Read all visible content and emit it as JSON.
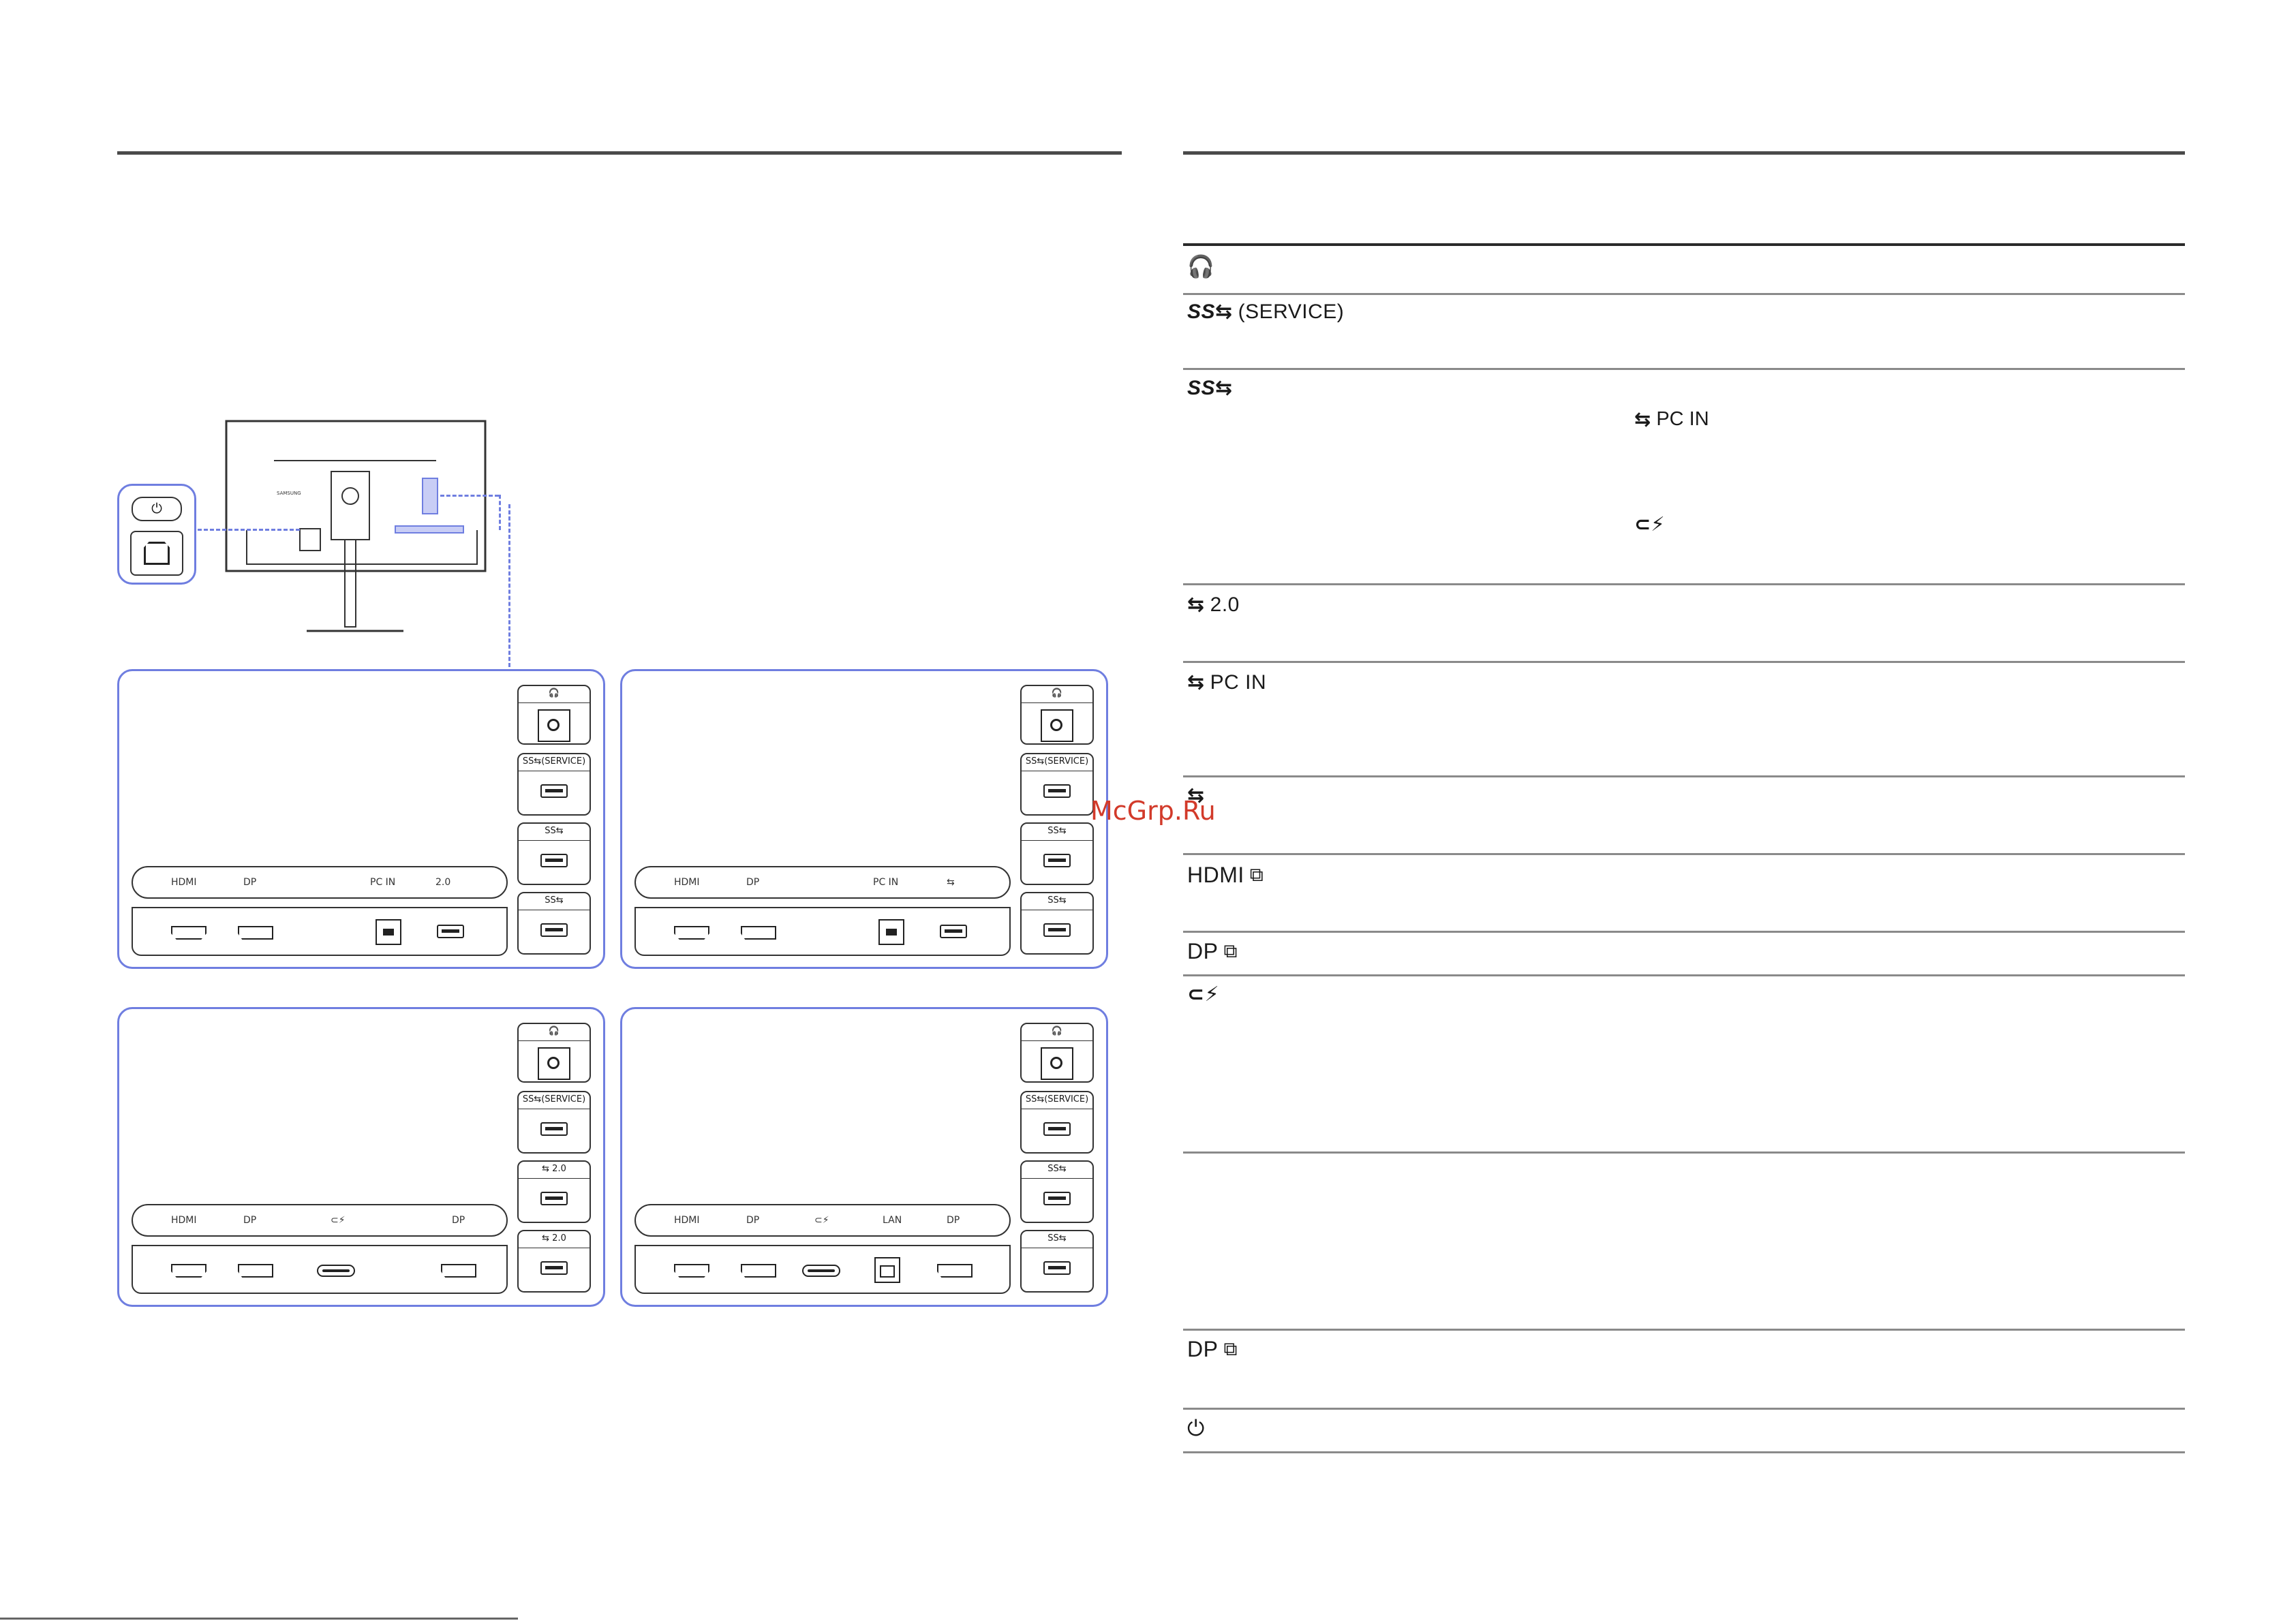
{
  "watermark": "McGrp.Ru",
  "ports_table": {
    "rows": [
      {
        "icon": "headphone-icon",
        "label": ""
      },
      {
        "icon": "usb-superspeed-icon",
        "label": "(SERVICE)"
      },
      {
        "icon": "usb-superspeed-icon",
        "label": ""
      },
      {
        "icon": "usb-icon",
        "label": "2.0"
      },
      {
        "icon": "usb-icon",
        "label": "PC IN"
      },
      {
        "icon": "usb-icon",
        "label": ""
      },
      {
        "icon": "hdmi-in-icon",
        "label": "HDMI"
      },
      {
        "icon": "dp-in-icon",
        "label": "DP"
      },
      {
        "icon": "usb-c-power-icon",
        "label": ""
      },
      {
        "icon": "",
        "label": ""
      },
      {
        "icon": "dp-out-icon",
        "label": "DP"
      },
      {
        "icon": "power-plug-icon",
        "label": ""
      }
    ],
    "inline_notes": [
      {
        "icon": "usb-icon",
        "label": "PC IN"
      },
      {
        "icon": "usb-c-power-icon",
        "label": ""
      }
    ]
  },
  "diagram": {
    "side_labels": {
      "service": "(SERVICE)",
      "usb20": "2.0"
    },
    "panels": [
      {
        "bar_labels": [
          "HDMI",
          "DP",
          "PC IN",
          "2.0"
        ]
      },
      {
        "bar_labels": [
          "HDMI",
          "DP",
          "PC IN",
          ""
        ]
      },
      {
        "bar_labels": [
          "HDMI",
          "DP",
          "",
          "DP"
        ]
      },
      {
        "bar_labels": [
          "HDMI",
          "DP",
          "",
          "LAN",
          "DP"
        ]
      }
    ]
  },
  "colors": {
    "panel_outline": "#6f7ee0",
    "watermark": "#d23a2a"
  }
}
